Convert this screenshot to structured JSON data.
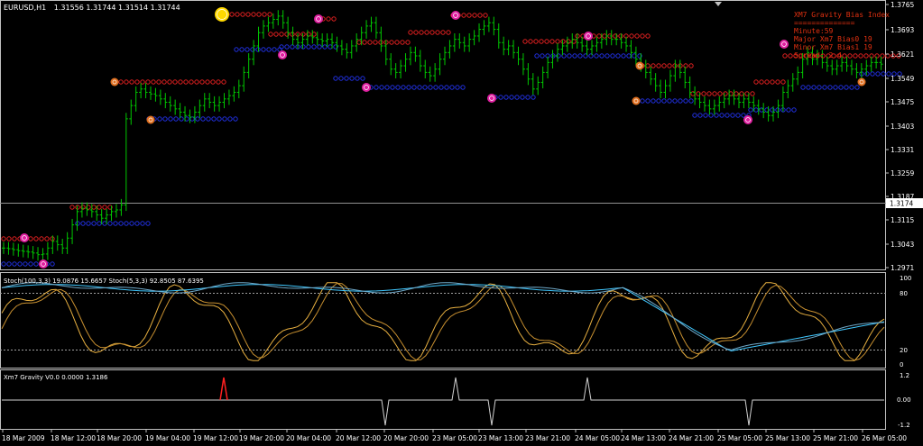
{
  "symbol_info": {
    "title": "EURUSD,H1",
    "ohlc": "1.31556 1.31744 1.31514 1.31744"
  },
  "info_panel": {
    "lines": [
      "XM7 Gravity Bias Index",
      "==============",
      "Minute:59",
      "Major Xm7 Bias0 19",
      "Minor Xm7 Bias1 19",
      "Spread: 2.4"
    ]
  },
  "colors": {
    "background": "#000000",
    "bull_candle": "#00c800",
    "frame": "#c0c0c0",
    "resistance_dots": "#e02020",
    "support_dots": "#2030e0",
    "stoch_main": "#40c8ff",
    "stoch_slow": "#e8b040",
    "gravity_line": "#d0d0d0",
    "gravity_spike": "#ff2020",
    "info_text": "#e03010",
    "marker_magenta": "#e020a0",
    "marker_orange": "#e07020",
    "marker_gold": "#ffd800"
  },
  "price_axis": [
    "1.3765",
    "1.3693",
    "1.3621",
    "1.3549",
    "1.3475",
    "1.3403",
    "1.3331",
    "1.3259",
    "1.3187",
    "1.3174",
    "1.3115",
    "1.3043",
    "1.2971"
  ],
  "current_price_label": "1.3174",
  "stoch_panel": {
    "label": "Stoch(100,3,3) 19.0876 15.6657  Stoch(5,3,3) 92.8505 87.6395",
    "levels": [
      "100",
      "80",
      "20",
      "0"
    ]
  },
  "gravity_panel": {
    "label": "Xm7 Gravity V0.0 0.0000 1.3186",
    "levels": [
      "1.2",
      "0.00",
      "-1.2"
    ]
  },
  "time_axis": [
    "18 Mar 2009",
    "18 Mar 12:00",
    "18 Mar 20:00",
    "19 Mar 04:00",
    "19 Mar 12:00",
    "19 Mar 20:00",
    "20 Mar 04:00",
    "20 Mar 12:00",
    "20 Mar 20:00",
    "23 Mar 05:00",
    "23 Mar 13:00",
    "23 Mar 21:00",
    "24 Mar 05:00",
    "24 Mar 13:00",
    "24 Mar 21:00",
    "25 Mar 05:00",
    "25 Mar 13:00",
    "25 Mar 21:00",
    "26 Mar 05:00"
  ],
  "chart_data": {
    "type": "candlestick",
    "price_range": [
      1.2971,
      1.3765
    ],
    "close_series": [
      1.303,
      1.3028,
      1.3025,
      1.3022,
      1.302,
      1.3018,
      1.3015,
      1.301,
      1.3012,
      1.303,
      1.305,
      1.304,
      1.303,
      1.306,
      1.31,
      1.314,
      1.315,
      1.3145,
      1.314,
      1.313,
      1.312,
      1.313,
      1.314,
      1.3145,
      1.316,
      1.342,
      1.346,
      1.35,
      1.351,
      1.35,
      1.3495,
      1.349,
      1.348,
      1.347,
      1.346,
      1.345,
      1.344,
      1.343,
      1.3425,
      1.344,
      1.346,
      1.348,
      1.347,
      1.346,
      1.347,
      1.348,
      1.349,
      1.35,
      1.352,
      1.356,
      1.36,
      1.364,
      1.368,
      1.37,
      1.371,
      1.372,
      1.373,
      1.371,
      1.368,
      1.366,
      1.365,
      1.366,
      1.367,
      1.3665,
      1.366,
      1.3655,
      1.366,
      1.365,
      1.364,
      1.363,
      1.362,
      1.364,
      1.366,
      1.368,
      1.37,
      1.371,
      1.368,
      1.364,
      1.36,
      1.357,
      1.356,
      1.358,
      1.36,
      1.362,
      1.361,
      1.358,
      1.356,
      1.355,
      1.357,
      1.36,
      1.362,
      1.364,
      1.366,
      1.365,
      1.364,
      1.366,
      1.367,
      1.369,
      1.37,
      1.371,
      1.369,
      1.365,
      1.363,
      1.364,
      1.362,
      1.36,
      1.357,
      1.354,
      1.351,
      1.353,
      1.356,
      1.359,
      1.361,
      1.363,
      1.364,
      1.365,
      1.366,
      1.365,
      1.364,
      1.363,
      1.364,
      1.365,
      1.366,
      1.367,
      1.366,
      1.366,
      1.365,
      1.364,
      1.362,
      1.36,
      1.358,
      1.356,
      1.354,
      1.352,
      1.35,
      1.352,
      1.355,
      1.358,
      1.356,
      1.353,
      1.35,
      1.348,
      1.347,
      1.346,
      1.345,
      1.346,
      1.347,
      1.348,
      1.349,
      1.348,
      1.347,
      1.348,
      1.347,
      1.346,
      1.345,
      1.344,
      1.343,
      1.344,
      1.346,
      1.35,
      1.352,
      1.354,
      1.356,
      1.36,
      1.362,
      1.36,
      1.361,
      1.359,
      1.358,
      1.357,
      1.358,
      1.359,
      1.358,
      1.357,
      1.356,
      1.357,
      1.358,
      1.359,
      1.359,
      1.3585
    ]
  }
}
